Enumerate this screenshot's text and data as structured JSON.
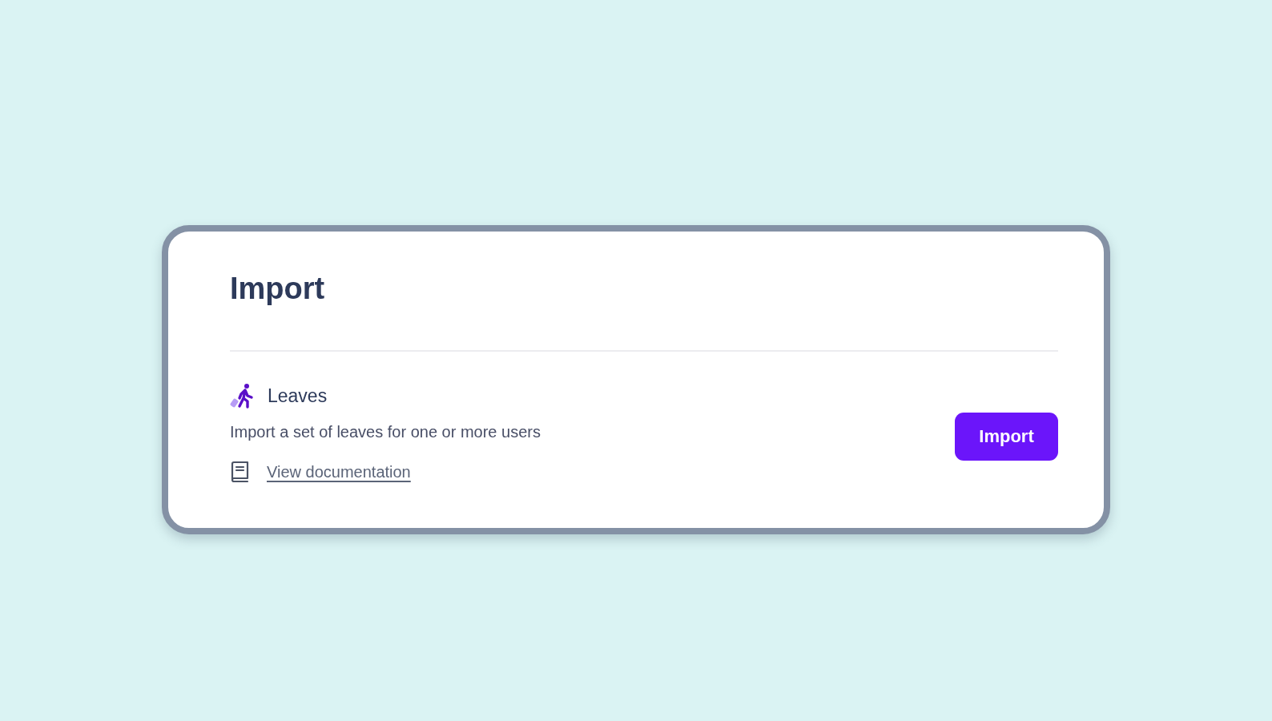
{
  "page": {
    "title": "Import"
  },
  "imports": [
    {
      "kind": "leaves",
      "name": "Leaves",
      "description": "Import a set of leaves for one or more users",
      "link": "View documentation",
      "button": "Import"
    }
  ]
}
